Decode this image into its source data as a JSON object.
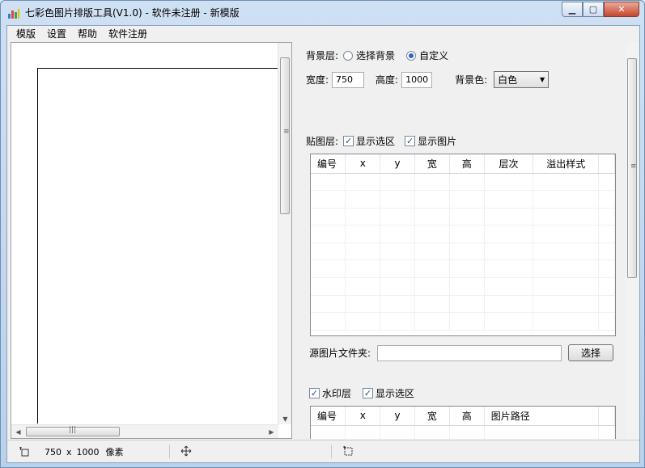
{
  "window": {
    "title": "七彩色图片排版工具(V1.0) - 软件未注册 - 新模版"
  },
  "menu": [
    "模版",
    "设置",
    "帮助",
    "软件注册"
  ],
  "background": {
    "layer_label": "背景层:",
    "options": [
      "选择背景",
      "自定义"
    ],
    "selected_option": "自定义",
    "width_label": "宽度:",
    "width_value": "750",
    "height_label": "高度:",
    "height_value": "1000",
    "bgcolor_label": "背景色:",
    "bgcolor_value": "白色"
  },
  "sticker": {
    "layer_label": "贴图层:",
    "show_selection": "显示选区",
    "show_image": "显示图片",
    "columns": [
      "编号",
      "x",
      "y",
      "宽",
      "高",
      "层次",
      "溢出样式"
    ],
    "source_folder_label": "源图片文件夹:",
    "source_folder_value": "",
    "choose_button": "选择"
  },
  "watermark": {
    "layer_label": "水印层",
    "show_selection": "显示选区",
    "columns": [
      "编号",
      "x",
      "y",
      "宽",
      "高",
      "图片路径"
    ]
  },
  "status": {
    "size_value": "750",
    "size_sep": "x",
    "size_value2": "1000",
    "unit": "像素"
  },
  "icons": {
    "app": "app-bar-chart-icon",
    "status1": "canvas-size-icon",
    "status2": "move-crosshair-icon",
    "status3": "selection-icon"
  }
}
